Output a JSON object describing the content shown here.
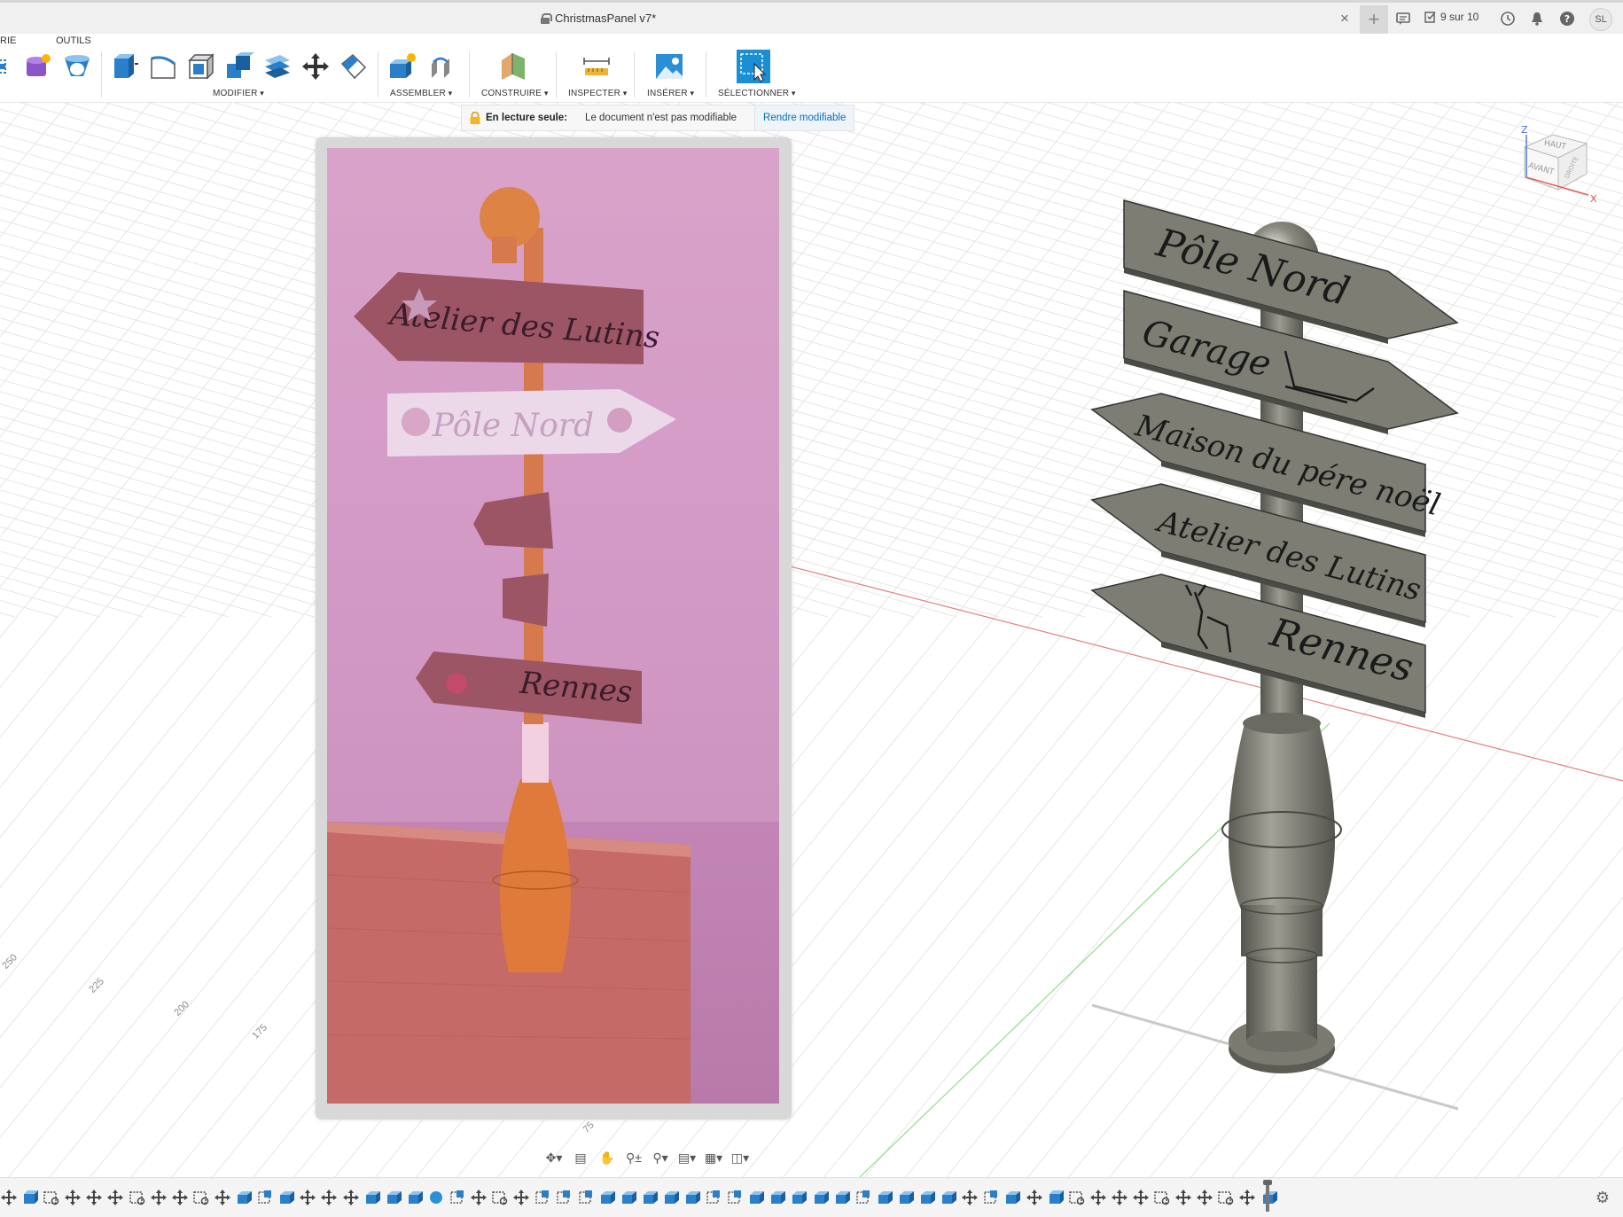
{
  "window": {
    "document_title": "ChristmasPanel v7*",
    "close_tab_glyph": "×",
    "new_tab_glyph": "+",
    "job_status": "9 sur 10",
    "user_initials": "SL"
  },
  "toolbar": {
    "tabs": [
      "RIE",
      "OUTILS"
    ],
    "groups": {
      "modify": "MODIFIER",
      "assemble": "ASSEMBLER",
      "construct": "CONSTRUIRE",
      "inspect": "INSPECTER",
      "insert": "INSÉRER",
      "select": "SÉLECTIONNER"
    },
    "tool_icons": [
      "sketch-icon",
      "form-icon",
      "revolve-icon",
      "press-pull-icon",
      "fillet-icon",
      "shell-icon",
      "combine-icon",
      "offset-face-icon",
      "move-icon",
      "split-body-icon",
      "new-component-icon",
      "joint-icon",
      "construct-plane-icon",
      "measure-icon",
      "canvas-image-icon",
      "select-icon"
    ]
  },
  "banner": {
    "title": "En lecture seule:",
    "message": "Le document n'est pas modifiable",
    "action": "Rendre modifiable"
  },
  "viewcube": {
    "top": "HAUT",
    "front": "AVANT",
    "right": "DROITE",
    "axis_x": "X",
    "axis_z": "Z"
  },
  "grid": {
    "axis_ticks": [
      "250",
      "225",
      "200",
      "175",
      "75"
    ]
  },
  "photo_signs": [
    "Atelier des Lutins",
    "Pôle Nord",
    "Rennes"
  ],
  "model_signs": [
    "Pôle Nord",
    "Garage",
    "Maison du pére noël",
    "Atelier des Lutins",
    "Rennes"
  ],
  "navbar_icons": [
    "orbit-icon",
    "look-at-icon",
    "pan-icon",
    "zoom-icon",
    "fit-icon",
    "display-settings-icon",
    "grid-settings-icon",
    "viewports-icon"
  ],
  "timeline": {
    "item_count": 60
  },
  "colors": {
    "accent_blue": "#0a6fb8",
    "select_blue": "#1a8fd6",
    "photo_tint": "#c98aa8",
    "model_gray": "#7d7d74",
    "grid_line": "#e6e6e6",
    "red_axis": "#e57f7f",
    "green_axis": "#8fdc8f"
  }
}
